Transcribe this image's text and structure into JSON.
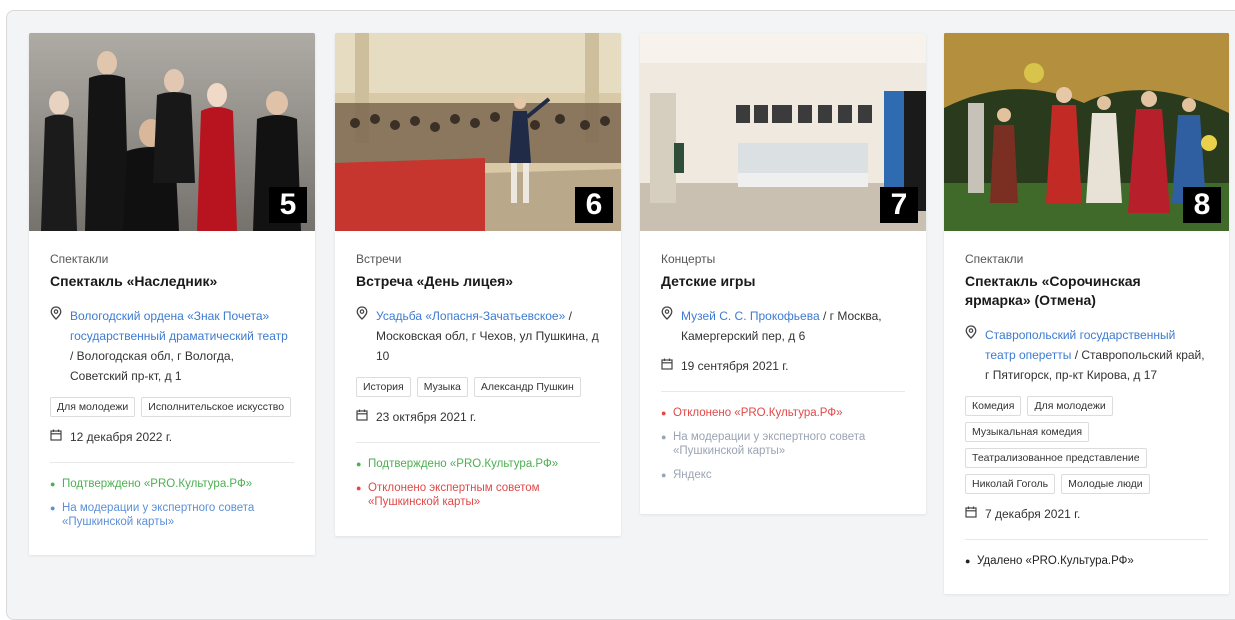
{
  "cards": [
    {
      "number": "5",
      "category": "Спектакли",
      "title": "Спектакль «Наследник»",
      "place_link": "Вологодский ордена «Знак Почета» государственный драматический театр",
      "place_address": " / Вологодская обл, г Вологда, Советский пр-кт, д 1",
      "tags": [
        "Для молодежи",
        "Исполнительское искусство"
      ],
      "date": "12 декабря 2022 г.",
      "statuses": [
        {
          "text": "Подтверждено «PRO.Культура.РФ»",
          "color": "#4caf50"
        },
        {
          "text": "На модерации у экспертного совета «Пушкинской карты»",
          "color": "#5b8fd6"
        }
      ]
    },
    {
      "number": "6",
      "category": "Встречи",
      "title": "Встреча «День лицея»",
      "place_link": "Усадьба «Лопасня-Зачатьевское»",
      "place_address": " / Московская обл, г Чехов, ул Пушкина, д 10",
      "tags": [
        "История",
        "Музыка",
        "Александр Пушкин"
      ],
      "date": "23 октября 2021 г.",
      "statuses": [
        {
          "text": "Подтверждено «PRO.Культура.РФ»",
          "color": "#4caf50"
        },
        {
          "text": "Отклонено экспертным советом «Пушкинской карты»",
          "color": "#e04848"
        }
      ]
    },
    {
      "number": "7",
      "category": "Концерты",
      "title": "Детские игры",
      "place_link": "Музей С. С. Прокофьева",
      "place_address": " / г Москва, Камергерский пер, д 6",
      "tags": [],
      "date": "19 сентября 2021 г.",
      "statuses": [
        {
          "text": "Отклонено «PRO.Культура.РФ»",
          "color": "#e04848"
        },
        {
          "text": "На модерации у экспертного совета «Пушкинской карты»",
          "color": "#9aa4b3"
        },
        {
          "text": "Яндекс",
          "color": "#9aa4b3"
        }
      ]
    },
    {
      "number": "8",
      "category": "Спектакли",
      "title": "Спектакль «Сорочинская ярмарка» (Отмена)",
      "place_link": "Ставропольский государственный театр оперетты",
      "place_address": " / Ставропольский край, г Пятигорск, пр-кт Кирова, д 17",
      "tags": [
        "Комедия",
        "Для молодежи",
        "Музыкальная комедия",
        "Театрализованное представление",
        "Николай Гоголь",
        "Молодые люди"
      ],
      "date": "7 декабря 2021 г.",
      "statuses": [
        {
          "text": "Удалено «PRO.Культура.РФ»",
          "color": "#222222"
        }
      ]
    }
  ],
  "icons": {
    "place": "map-pin-icon",
    "date": "calendar-icon",
    "status": "dot-icon"
  }
}
